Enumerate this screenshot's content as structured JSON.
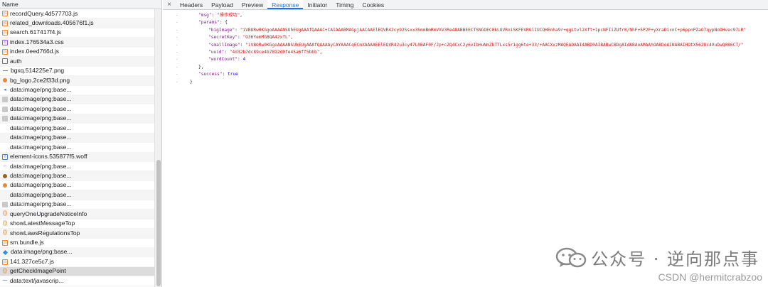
{
  "left_header": "Name",
  "requests": [
    {
      "name": "recordQuery.4d577703.js",
      "icon": "js-file-icon"
    },
    {
      "name": "related_downloads.405676f1.js",
      "icon": "js-file-icon"
    },
    {
      "name": "search.617417f4.js",
      "icon": "js-file-icon"
    },
    {
      "name": "index.176534a3.css",
      "icon": "css-file-icon"
    },
    {
      "name": "index.0eed766d.js",
      "icon": "js-file-icon"
    },
    {
      "name": "auth",
      "icon": "document-icon"
    },
    {
      "name": "bgxq.514225e7.png",
      "icon": "line-image-icon"
    },
    {
      "name": "bg_logo.2ce2f33d.png",
      "icon": "logo-image-icon"
    },
    {
      "name": "data:image/png;base...",
      "icon": "blue-image-icon"
    },
    {
      "name": "data:image/png;base...",
      "icon": "image-icon"
    },
    {
      "name": "data:image/png;base...",
      "icon": "image-icon"
    },
    {
      "name": "data:image/png;base...",
      "icon": "image-icon"
    },
    {
      "name": "data:image/png;base...",
      "icon": "blank-icon"
    },
    {
      "name": "data:image/png;base...",
      "icon": "blank-icon"
    },
    {
      "name": "data:image/png;base...",
      "icon": "blank-icon"
    },
    {
      "name": "element-icons.535877f5.woff",
      "icon": "font-file-icon"
    },
    {
      "name": "data:image/png;base...",
      "icon": "arrow-image-icon"
    },
    {
      "name": "data:image/png;base...",
      "icon": "brown-dot-icon"
    },
    {
      "name": "data:image/png;base...",
      "icon": "orange-dot-icon"
    },
    {
      "name": "data:image/png;base...",
      "icon": "blank-icon"
    },
    {
      "name": "data:image/png;base...",
      "icon": "image-icon"
    },
    {
      "name": "queryOneUpgradeNoticeInfo",
      "icon": "fetch-icon"
    },
    {
      "name": "showLatestMessageTop",
      "icon": "fetch-icon"
    },
    {
      "name": "showLawsRegulationsTop",
      "icon": "fetch-icon"
    },
    {
      "name": "sm.bundle.js",
      "icon": "js-file-icon"
    },
    {
      "name": "data:image/png;base...",
      "icon": "blue-diamond-icon"
    },
    {
      "name": "141.327ce5c7.js",
      "icon": "js-file-icon"
    },
    {
      "name": "getCheckImagePoint",
      "icon": "fetch-icon",
      "selected": true
    },
    {
      "name": "data:text/javascrip...",
      "icon": "dash-icon"
    }
  ],
  "tabs": {
    "close": "×",
    "items": [
      "Headers",
      "Payload",
      "Preview",
      "Response",
      "Initiator",
      "Timing",
      "Cookies"
    ],
    "active": "Response"
  },
  "response": {
    "msg_key": "\"msg\"",
    "msg_val": "\"操作成功\"",
    "params_key": "\"params\"",
    "bigImage_key": "\"bigImage\"",
    "bigImage_val": "\"iVBORw0KGgoAAAANSUhEUgAAAfQAAAC+CAIAAABMAGpjAACAAElEQVR42cy925sxx3SmmBmRmVXV3Re48ABBEECTSNGOEC0kLUVRoiSKFEVRGlIUCQHEnha9r+qgLtvl2Xft+1pcNFIiZUfr0/NhF+5P2F+yXraDicnC+p6ppnPZaO7qypNoDHvec97LR\"",
    "secretKey_key": "\"secretKey\"",
    "secretKey_val": "\"O36YemMGBQA42xfL\"",
    "smallImage_key": "\"smallImage\"",
    "smallImage_val": "\"iVBORw0KGgoAAAANSUhEUgAAAfQAAAAyCAYAAACqECmXAAAAEElEQVR42u3cy47L0BAF0F/Jp+cZQ4CxC2y6vIbHuNmZbTTLxs5r1gg6te+33/+AACXxzMAQEADAAI4ABD0AIBABwCBDgAIdABAoAMAAhOABDoAINABAIHOtX562Uc4VuDwQ086CT/\"",
    "uuid_key": "\"uuid\"",
    "uuid_val": "\"4d32b7dc89ce4b7892d0fe45a6ff5bbb\"",
    "wordCount_key": "\"wordCount\"",
    "wordCount_val": "4",
    "success_key": "\"success\"",
    "success_val": "true",
    "gutter": "-"
  },
  "watermark": {
    "title": "公众号 · 逆向那点事",
    "sub": "CSDN @hermitcrabzoo"
  }
}
